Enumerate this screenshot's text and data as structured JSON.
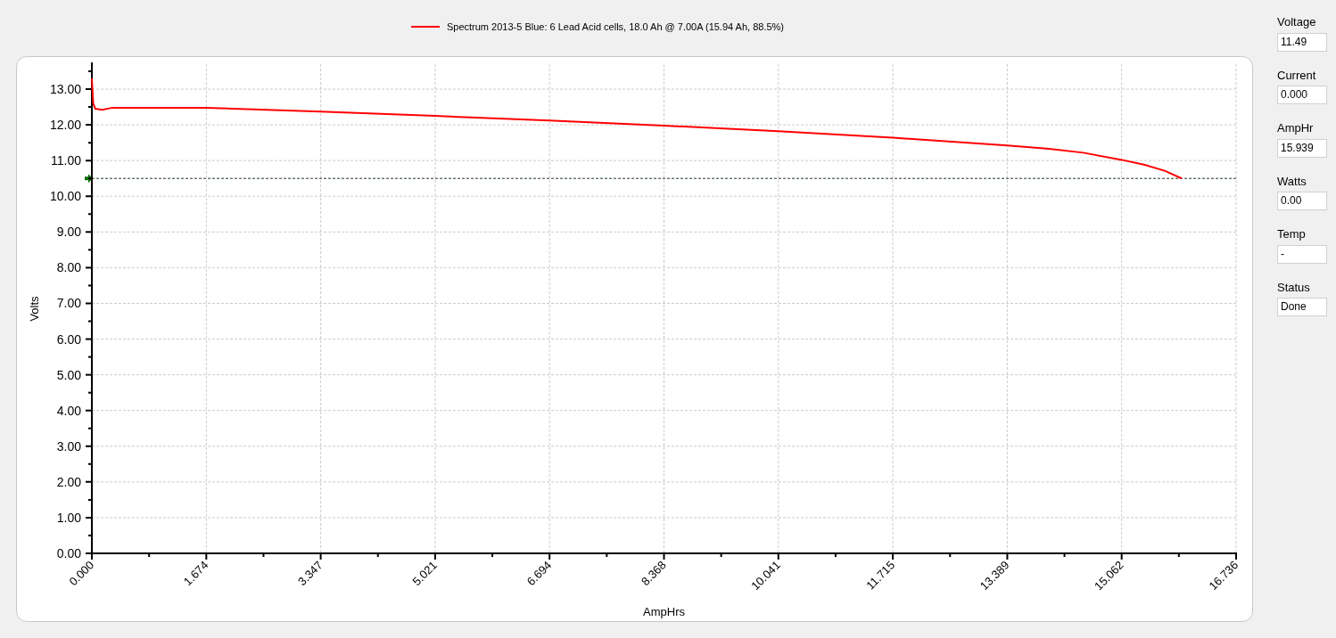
{
  "chart": {
    "chart_data": {
      "type": "line",
      "xlabel": "AmpHrs",
      "ylabel": "Volts",
      "x": [
        0,
        0.02,
        0.05,
        0.15,
        0.3,
        1.674,
        3.347,
        5.021,
        6.694,
        8.368,
        10.041,
        11.715,
        13.389,
        14.0,
        14.5,
        15.062,
        15.4,
        15.7,
        15.939
      ],
      "series": [
        {
          "name": "Spectrum 2013-5 Blue: 6 Lead Acid cells, 18.0 Ah @ 7.00A (15.94 Ah, 88.5%)",
          "color": "#ff0000",
          "values": [
            13.3,
            12.6,
            12.45,
            12.42,
            12.48,
            12.48,
            12.37,
            12.25,
            12.12,
            11.98,
            11.82,
            11.64,
            11.42,
            11.33,
            11.22,
            11.02,
            10.88,
            10.71,
            10.5
          ]
        }
      ],
      "xlim": [
        0,
        16.736
      ],
      "ylim": [
        0,
        13.7
      ],
      "xticks": [
        {
          "value": 0,
          "label": "0.000"
        },
        {
          "value": 1.674,
          "label": "1.674"
        },
        {
          "value": 3.347,
          "label": "3.347"
        },
        {
          "value": 5.021,
          "label": "5.021"
        },
        {
          "value": 6.694,
          "label": "6.694"
        },
        {
          "value": 8.368,
          "label": "8.368"
        },
        {
          "value": 10.041,
          "label": "10.041"
        },
        {
          "value": 11.715,
          "label": "11.715"
        },
        {
          "value": 13.389,
          "label": "13.389"
        },
        {
          "value": 15.062,
          "label": "15.062"
        },
        {
          "value": 16.736,
          "label": "16.736"
        }
      ],
      "yticks": [
        {
          "value": 0,
          "label": "0.00"
        },
        {
          "value": 1,
          "label": "1.00"
        },
        {
          "value": 2,
          "label": "2.00"
        },
        {
          "value": 3,
          "label": "3.00"
        },
        {
          "value": 4,
          "label": "4.00"
        },
        {
          "value": 5,
          "label": "5.00"
        },
        {
          "value": 6,
          "label": "6.00"
        },
        {
          "value": 7,
          "label": "7.00"
        },
        {
          "value": 8,
          "label": "8.00"
        },
        {
          "value": 9,
          "label": "9.00"
        },
        {
          "value": 10,
          "label": "10.00"
        },
        {
          "value": 11,
          "label": "11.00"
        },
        {
          "value": 12,
          "label": "12.00"
        },
        {
          "value": 13,
          "label": "13.00"
        }
      ],
      "grid": true,
      "ref_lines": [
        {
          "axis": "y",
          "value": 10.5
        }
      ]
    }
  },
  "readouts": [
    {
      "label": "Voltage",
      "value": "11.49"
    },
    {
      "label": "Current",
      "value": "0.000"
    },
    {
      "label": "AmpHr",
      "value": "15.939"
    },
    {
      "label": "Watts",
      "value": "0.00"
    },
    {
      "label": "Temp",
      "value": "-"
    },
    {
      "label": "Status",
      "value": "Done"
    }
  ]
}
